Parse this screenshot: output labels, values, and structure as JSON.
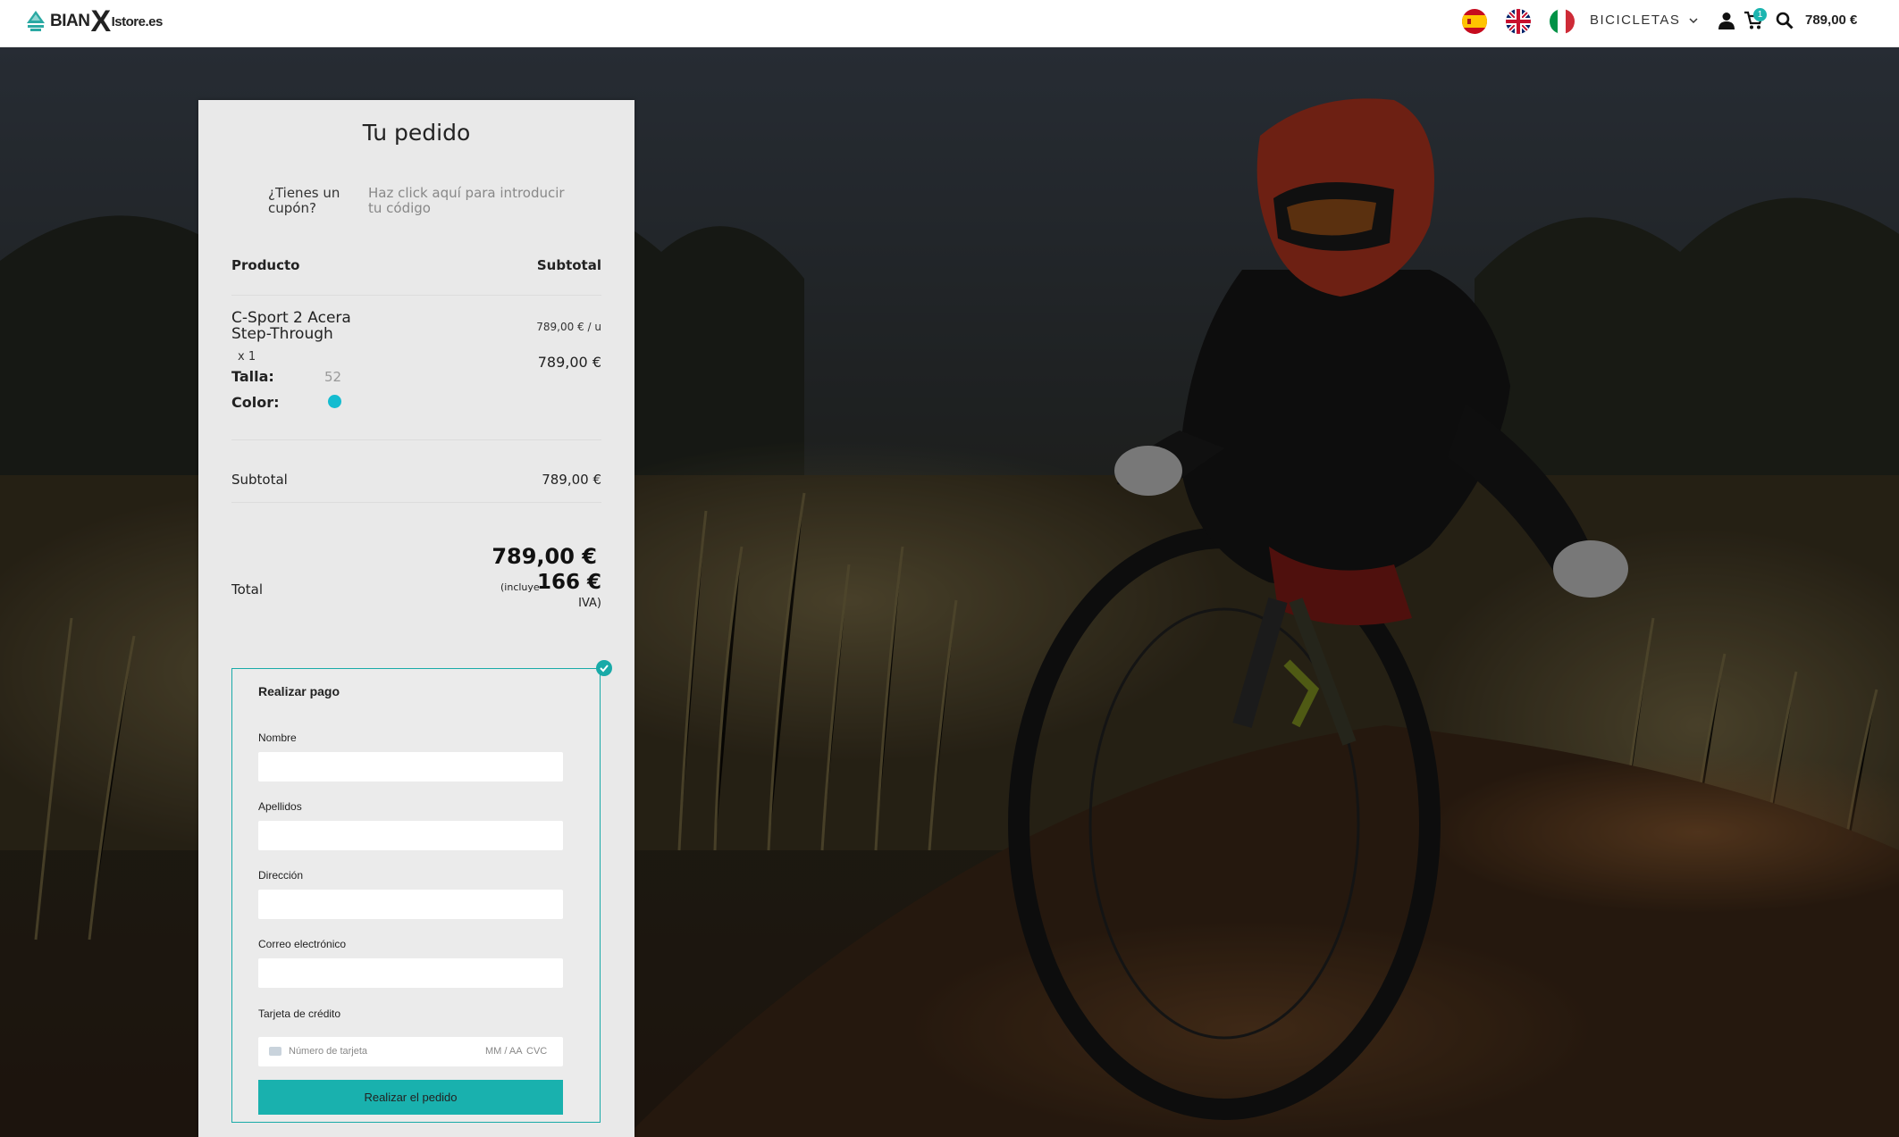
{
  "header": {
    "logo_part_a": "BIAN",
    "logo_part_x": "X",
    "logo_part_b": "Istore.es",
    "languages": [
      "spain-flag-icon",
      "uk-flag-icon",
      "italy-flag-icon"
    ],
    "menu_bikes": "BICICLETAS",
    "cart_count": "1",
    "cart_total": "789,00 €"
  },
  "order": {
    "title": "Tu pedido",
    "coupon_question": "¿Tienes un cupón?",
    "coupon_link": "Haz click aquí para introducir tu código",
    "col_product": "Producto",
    "col_subtotal": "Subtotal",
    "item": {
      "name": "C-Sport 2 Acera Step-Through",
      "quantity": "x 1",
      "unit_price": "789,00 € / u",
      "line_total": "789,00 €",
      "size_label": "Talla:",
      "size_value": "52",
      "color_label": "Color:",
      "color_hex": "#14bcd0"
    },
    "subtotal_label": "Subtotal",
    "subtotal_value": "789,00 €",
    "total_label": "Total",
    "total_value": "789,00 €",
    "tax_prefix": "(incluye",
    "tax_value": "166 €",
    "tax_suffix": "IVA)"
  },
  "payment": {
    "title": "Realizar pago",
    "first_name_label": "Nombre",
    "last_name_label": "Apellidos",
    "address_label": "Dirección",
    "email_label": "Correo electrónico",
    "card_label": "Tarjeta de crédito",
    "card_number_placeholder": "Número de tarjeta",
    "card_expiry_placeholder": "MM / AA",
    "card_cvc_placeholder": "CVC",
    "submit_label": "Realizar el pedido"
  },
  "colors": {
    "accent": "#19b1ae",
    "panel_bg": "#e9e9e9"
  }
}
